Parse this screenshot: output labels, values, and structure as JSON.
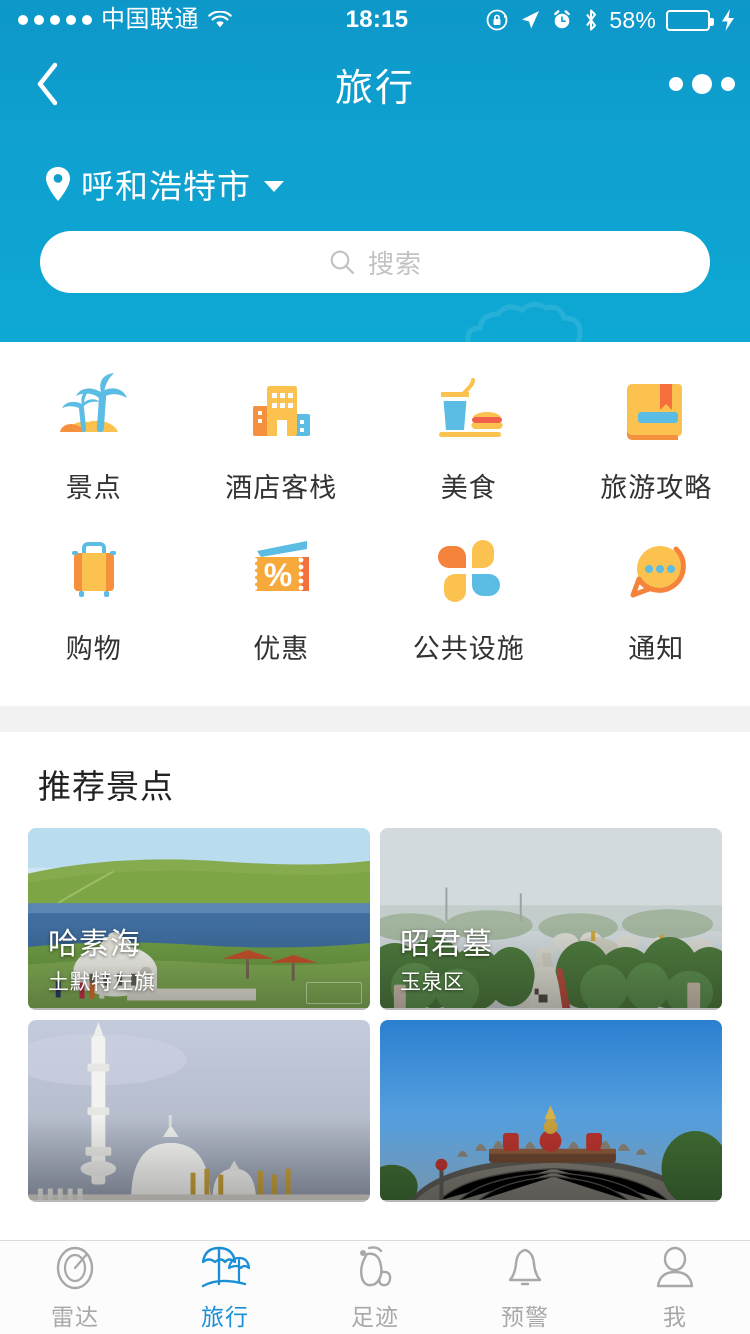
{
  "status_bar": {
    "carrier": "中国联通",
    "signal_dots": 5,
    "wifi_icon": "wifi-icon",
    "time": "18:15",
    "icons": [
      "rotation-lock-icon",
      "location-arrow-icon",
      "alarm-clock-icon",
      "bluetooth-icon"
    ],
    "battery_percent": "58%",
    "battery_level": 58,
    "charging": true
  },
  "navbar": {
    "back_icon": "chevron-left-icon",
    "title": "旅行",
    "more_icon": "more-dots-icon"
  },
  "location": {
    "pin_icon": "location-pin-icon",
    "city": "呼和浩特市",
    "caret_icon": "chevron-down-icon"
  },
  "search": {
    "icon": "search-icon",
    "placeholder": "搜索",
    "value": ""
  },
  "grid": {
    "items": [
      {
        "label": "景点",
        "icon": "palm-tree-icon"
      },
      {
        "label": "酒店客栈",
        "icon": "hotel-buildings-icon"
      },
      {
        "label": "美食",
        "icon": "food-drink-icon"
      },
      {
        "label": "旅游攻略",
        "icon": "guide-book-icon"
      },
      {
        "label": "购物",
        "icon": "suitcase-icon"
      },
      {
        "label": "优惠",
        "icon": "coupon-percent-icon"
      },
      {
        "label": "公共设施",
        "icon": "four-petal-icon"
      },
      {
        "label": "通知",
        "icon": "chat-bubble-icon"
      }
    ]
  },
  "recommend": {
    "title": "推荐景点",
    "cards": [
      {
        "name": "哈素海",
        "sub": "土默特左旗",
        "image": "grassland-lake-yurt-photo"
      },
      {
        "name": "昭君墓",
        "sub": "玉泉区",
        "image": "hazy-park-avenue-photo"
      },
      {
        "name": "",
        "sub": "",
        "image": "white-mosque-domes-photo"
      },
      {
        "name": "",
        "sub": "",
        "image": "temple-roof-blue-sky-photo"
      }
    ]
  },
  "tabbar": {
    "items": [
      {
        "label": "雷达",
        "icon": "radar-icon",
        "active": false
      },
      {
        "label": "旅行",
        "icon": "parasol-icon",
        "active": true
      },
      {
        "label": "足迹",
        "icon": "footprint-icon",
        "active": false
      },
      {
        "label": "预警",
        "icon": "bell-icon",
        "active": false
      },
      {
        "label": "我",
        "icon": "person-icon",
        "active": false
      }
    ]
  },
  "colors": {
    "header_top": "#0d97c9",
    "header_bottom": "#0ea8d4",
    "accent_blue": "#1b8fd6",
    "icon_orange": "#f5903c",
    "icon_yellow": "#fcc250",
    "icon_light_blue": "#5bbce4",
    "battery_green": "#4cd964",
    "divider_gray": "#f2f2f2",
    "tab_inactive": "#a8a8a8"
  }
}
